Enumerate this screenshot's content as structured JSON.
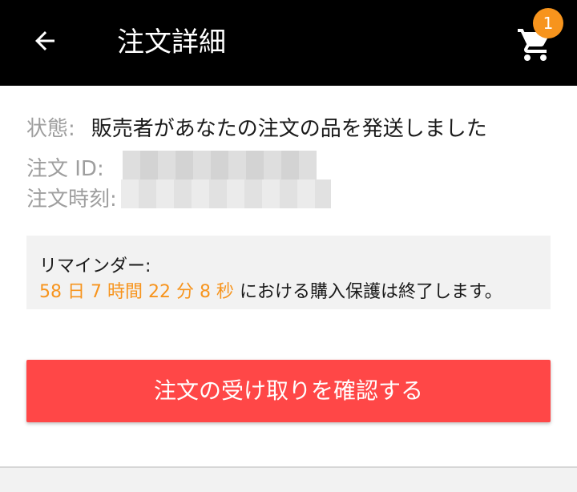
{
  "header": {
    "title": "注文詳細",
    "back_icon": "arrow-left",
    "cart_icon": "shopping-cart",
    "cart_badge": "1"
  },
  "order": {
    "status_label": "状態:",
    "status_value": "販売者があなたの注文の品を発送しました",
    "id_label": "注文 ID:",
    "time_label": "注文時刻:"
  },
  "reminder": {
    "title": "リマインダー:",
    "countdown": "58 日 7 時間 22 分 8 秒",
    "suffix": "における購入保護は終了します。"
  },
  "actions": {
    "confirm_label": "注文の受け取りを確認する"
  },
  "colors": {
    "header_bg": "#000000",
    "accent_orange": "#f7941d",
    "button_red": "#ff4747"
  }
}
